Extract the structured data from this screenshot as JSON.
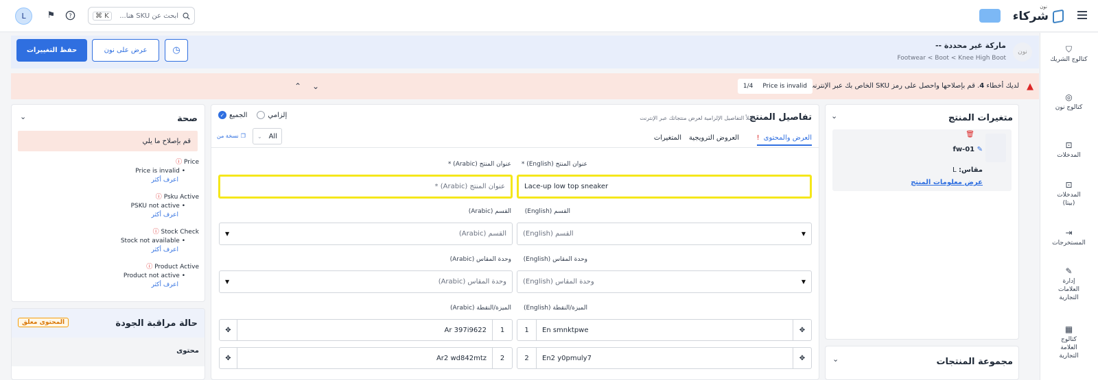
{
  "topbar": {
    "logo_text": "شركاء",
    "logo_sub": "نون",
    "search_placeholder": "ابحث عن SKU هنا...",
    "shortcut": "⌘ K",
    "avatar": "L"
  },
  "sidebar": {
    "items": [
      {
        "label": "كتالوج الشريك",
        "icon": "shirt-icon"
      },
      {
        "label": "كتالوج نون",
        "icon": "globe-icon"
      },
      {
        "label": "المدخلات",
        "icon": "inbox-icon"
      },
      {
        "label": "المدخلات (بيتا)",
        "icon": "inbox-beta-icon"
      },
      {
        "label": "المستخرجات",
        "icon": "export-icon"
      },
      {
        "label": "إدارة العلامات التجارية",
        "icon": "brand-icon"
      },
      {
        "label": "كتالوج العلامة التجارية",
        "icon": "brand-catalog-icon"
      }
    ]
  },
  "brand": {
    "placeholder": "نون",
    "title": "ماركة غير محددة --",
    "path": "Footwear < Boot < Knee High Boot",
    "save_label": "حفظ التغييرات",
    "view_label": "عرض على نون"
  },
  "errors": {
    "text_prefix": "لديك أخطاء",
    "count": "4",
    "text_suffix": ". قم بإصلاحها واحصل على رمز SKU الخاص بك عبر الإنترنت",
    "current": "Price is invalid",
    "position": "1/4"
  },
  "variants": {
    "title": "متغيرات المنتج",
    "sku": "fw-01",
    "size_label": "مقاس:",
    "size_value": "L",
    "link": "عرض معلومات المنتج",
    "group_title": "مجموعة المنتجات"
  },
  "details": {
    "title": "تفاصيل المنتج",
    "subtitle": "املأ التفاصيل الإلزامية لعرض منتجاتك عبر الإنترنت",
    "filter_mandatory": "إلزامي",
    "filter_all": "الجميع",
    "tabs": [
      "العرض والمحتوى",
      "العروض الترويجية",
      "المتغيرات"
    ],
    "lang_select": "All",
    "copy_from": "نسخة من",
    "title_en_label": "* (English) عنوان المنتج",
    "title_en_value": "Lace-up low top sneaker",
    "title_ar_label": "عنوان المنتج (Arabic) *",
    "title_ar_placeholder": "عنوان المنتج (Arabic) *",
    "dept_en_label": "(English) القسم",
    "dept_en_placeholder": "(English) القسم",
    "dept_ar_label": "القسم (Arabic)",
    "dept_ar_placeholder": "القسم (Arabic)",
    "unit_en_label": "(English) وحدة المقاس",
    "unit_en_placeholder": "(English) وحدة المقاس",
    "unit_ar_label": "وحدة المقاس (Arabic)",
    "unit_ar_placeholder": "وحدة المقاس (Arabic)",
    "feat_en_label": "(English) الميزة/النقطة",
    "feat_ar_label": "الميزة/النقطة (Arabic)",
    "features_en": [
      {
        "n": "1",
        "v": "En smnktpwe"
      },
      {
        "n": "2",
        "v": "En2 y0pmuly7"
      }
    ],
    "features_ar": [
      {
        "n": "1",
        "v": "Ar 397i9622"
      },
      {
        "n": "2",
        "v": "Ar2 wd842mtz"
      }
    ]
  },
  "health": {
    "title": "صحة",
    "notice": "قم بإصلاح ما يلي",
    "learn_more": "اعرف أكثر",
    "items": [
      {
        "name": "Price",
        "detail": "Price is invalid"
      },
      {
        "name": "Psku Active",
        "detail": "PSKU not active"
      },
      {
        "name": "Stock Check",
        "detail": "Stock not available"
      },
      {
        "name": "Product Active",
        "detail": "Product not active"
      }
    ]
  },
  "qc": {
    "title": "حالة مراقبة الجودة",
    "badge": "المحتوى معلق",
    "row": "محتوى"
  }
}
